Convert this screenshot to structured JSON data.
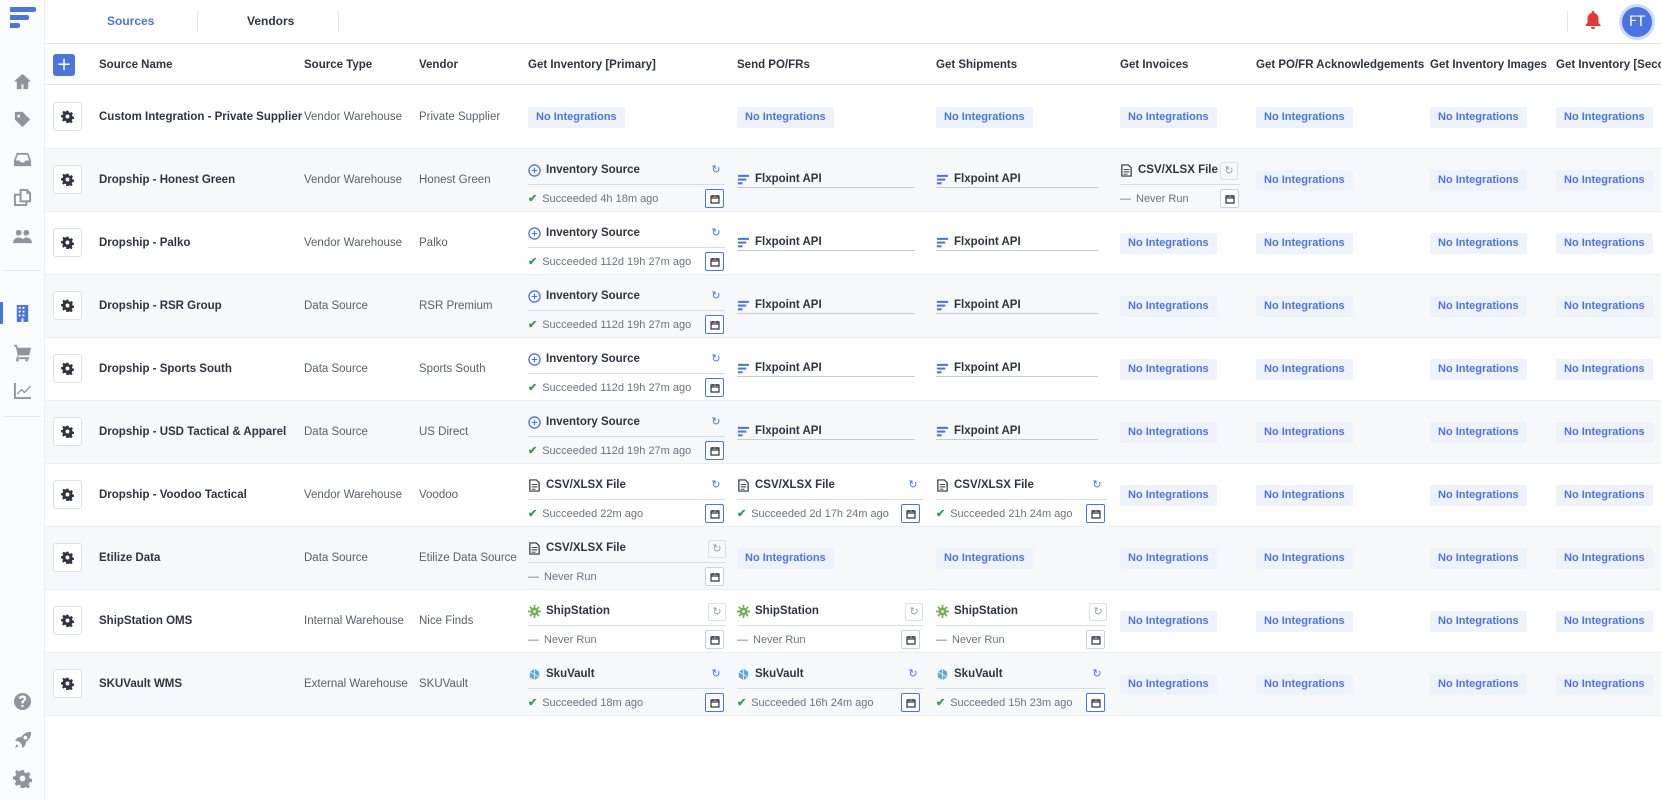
{
  "topbar": {
    "tabs": [
      {
        "label": "Sources"
      },
      {
        "label": "Vendors"
      }
    ],
    "avatar_initials": "FT"
  },
  "colors": {
    "accent": "#4a74e0",
    "success": "#2e9e5b",
    "alert": "#e53935"
  },
  "sidebar": {
    "icons": [
      "home-icon",
      "tag-icon",
      "inbox-icon",
      "documents-icon",
      "users-icon",
      "building-icon",
      "cart-icon",
      "chart-icon",
      "help-icon",
      "rocket-icon",
      "gear-icon"
    ],
    "active": "building-icon"
  },
  "table": {
    "headers": [
      "Source Name",
      "Source Type",
      "Vendor",
      "Get Inventory [Primary]",
      "Send PO/FRs",
      "Get Shipments",
      "Get Invoices",
      "Get PO/FR Acknowledgements",
      "Get Inventory Images",
      "Get Inventory [Seco"
    ],
    "no_integrations": "No Integrations",
    "rows": [
      {
        "name": "Custom Integration - Private Supplier",
        "type": "Vendor Warehouse",
        "vendor": "Private Supplier",
        "inv": null,
        "po": null,
        "ship": null,
        "invoices": null
      },
      {
        "name": "Dropship - Honest Green",
        "type": "Vendor Warehouse",
        "vendor": "Honest Green",
        "inv": {
          "icon": "inventory-source-icon",
          "label": "Inventory Source",
          "status": "Succeeded 4h 18m ago",
          "ok": true
        },
        "po": {
          "api": "Flxpoint API"
        },
        "ship": {
          "api": "Flxpoint API"
        },
        "invoices": {
          "icon": "file-icon",
          "label": "CSV/XLSX File",
          "status": "Never Run",
          "ok": false
        }
      },
      {
        "name": "Dropship - Palko",
        "type": "Vendor Warehouse",
        "vendor": "Palko",
        "inv": {
          "icon": "inventory-source-icon",
          "label": "Inventory Source",
          "status": "Succeeded 112d 19h 27m ago",
          "ok": true
        },
        "po": {
          "api": "Flxpoint API"
        },
        "ship": {
          "api": "Flxpoint API"
        },
        "invoices": null
      },
      {
        "name": "Dropship - RSR Group",
        "type": "Data Source",
        "vendor": "RSR Premium",
        "inv": {
          "icon": "inventory-source-icon",
          "label": "Inventory Source",
          "status": "Succeeded 112d 19h 27m ago",
          "ok": true
        },
        "po": {
          "api": "Flxpoint API"
        },
        "ship": {
          "api": "Flxpoint API"
        },
        "invoices": null
      },
      {
        "name": "Dropship - Sports South",
        "type": "Data Source",
        "vendor": "Sports South",
        "inv": {
          "icon": "inventory-source-icon",
          "label": "Inventory Source",
          "status": "Succeeded 112d 19h 27m ago",
          "ok": true
        },
        "po": {
          "api": "Flxpoint API"
        },
        "ship": {
          "api": "Flxpoint API"
        },
        "invoices": null
      },
      {
        "name": "Dropship - USD Tactical & Apparel",
        "type": "Data Source",
        "vendor": "US Direct",
        "inv": {
          "icon": "inventory-source-icon",
          "label": "Inventory Source",
          "status": "Succeeded 112d 19h 27m ago",
          "ok": true
        },
        "po": {
          "api": "Flxpoint API"
        },
        "ship": {
          "api": "Flxpoint API"
        },
        "invoices": null
      },
      {
        "name": "Dropship - Voodoo Tactical",
        "type": "Vendor Warehouse",
        "vendor": "Voodoo",
        "inv": {
          "icon": "file-icon",
          "label": "CSV/XLSX File",
          "status": "Succeeded 22m ago",
          "ok": true
        },
        "po": {
          "icon": "file-icon",
          "label": "CSV/XLSX File",
          "status": "Succeeded 2d 17h 24m ago",
          "ok": true
        },
        "ship": {
          "icon": "file-icon",
          "label": "CSV/XLSX File",
          "status": "Succeeded 21h 24m ago",
          "ok": true
        },
        "invoices": null
      },
      {
        "name": "Etilize Data",
        "type": "Data Source",
        "vendor": "Etilize Data Source",
        "inv": {
          "icon": "file-icon",
          "label": "CSV/XLSX File",
          "status": "Never Run",
          "ok": false
        },
        "po": null,
        "ship": null,
        "invoices": null
      },
      {
        "name": "ShipStation OMS",
        "type": "Internal Warehouse",
        "vendor": "Nice Finds",
        "inv": {
          "icon": "shipstation-icon",
          "label": "ShipStation",
          "status": "Never Run",
          "ok": false
        },
        "po": {
          "icon": "shipstation-icon",
          "label": "ShipStation",
          "status": "Never Run",
          "ok": false
        },
        "ship": {
          "icon": "shipstation-icon",
          "label": "ShipStation",
          "status": "Never Run",
          "ok": false
        },
        "invoices": null
      },
      {
        "name": "SKUVault WMS",
        "type": "External Warehouse",
        "vendor": "SKUVault",
        "inv": {
          "icon": "skuvault-icon",
          "label": "SkuVault",
          "status": "Succeeded 18m ago",
          "ok": true
        },
        "po": {
          "icon": "skuvault-icon",
          "label": "SkuVault",
          "status": "Succeeded 16h 24m ago",
          "ok": true
        },
        "ship": {
          "icon": "skuvault-icon",
          "label": "SkuVault",
          "status": "Succeeded 15h 23m ago",
          "ok": true
        },
        "invoices": null
      }
    ]
  }
}
